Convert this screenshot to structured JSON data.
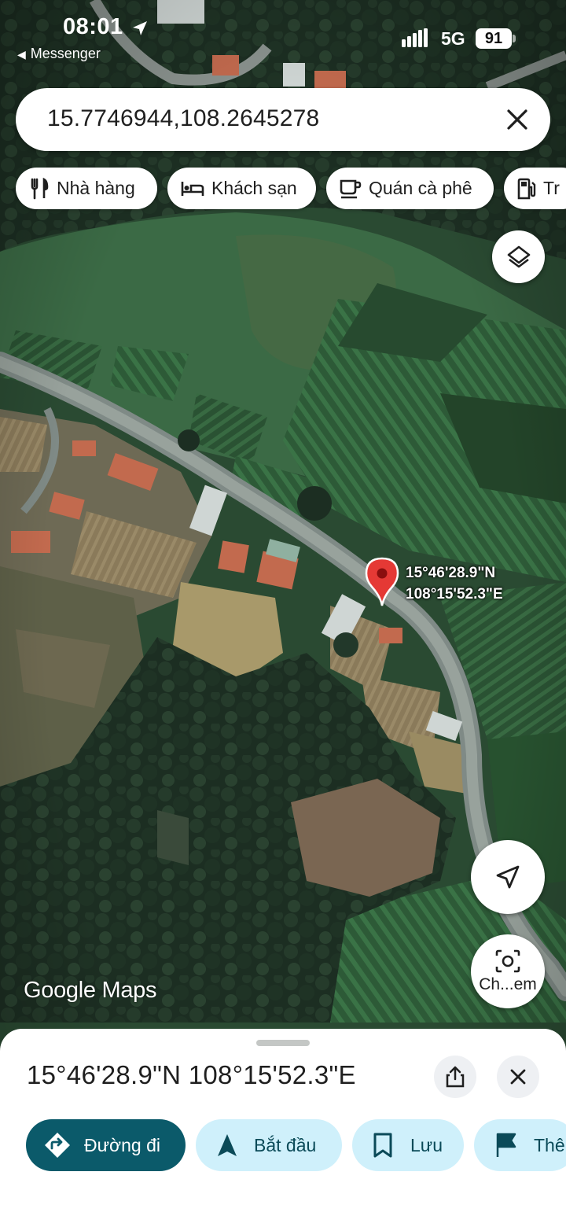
{
  "status_bar": {
    "time": "08:01",
    "back_label": "Messenger",
    "network": "5G",
    "battery": "91"
  },
  "search": {
    "query": "15.7746944,108.2645278"
  },
  "chips": [
    {
      "label": "Nhà hàng",
      "icon": "fork-knife-icon"
    },
    {
      "label": "Khách sạn",
      "icon": "bed-icon"
    },
    {
      "label": "Quán cà phê",
      "icon": "coffee-cup-icon"
    },
    {
      "label": "Tr",
      "icon": "gas-station-icon"
    }
  ],
  "map": {
    "pin_label_lat": "15°46'28.9\"N",
    "pin_label_lng": "108°15'52.3\"E",
    "watermark": "Google Maps",
    "layers_icon": "layers-icon",
    "my_location_icon": "navigation-arrow-icon",
    "lens_label": "Ch...em"
  },
  "sheet": {
    "title": "15°46'28.9\"N 108°15'52.3\"E",
    "actions": [
      {
        "label": "Đường đi",
        "icon": "directions-icon"
      },
      {
        "label": "Bắt đầu",
        "icon": "navigation-icon"
      },
      {
        "label": "Lưu",
        "icon": "bookmark-icon"
      },
      {
        "label": "Thê",
        "icon": "flag-icon"
      }
    ]
  },
  "colors": {
    "primary_action": "#0b5a6a",
    "secondary_action": "#cff0fb",
    "pin": "#e53935"
  }
}
